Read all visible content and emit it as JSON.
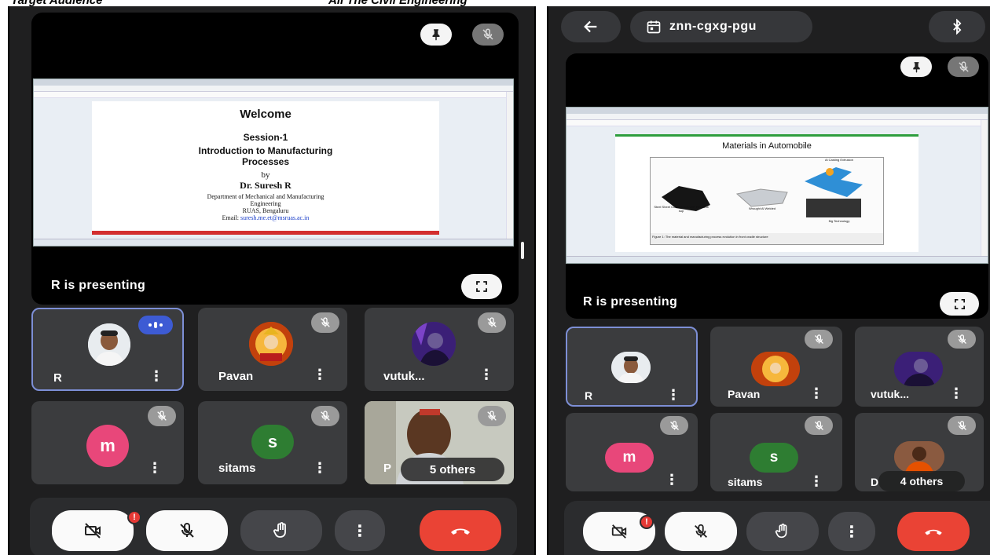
{
  "captions": {
    "left": "Target Audience",
    "right": "All The Civil Engineering"
  },
  "left_panel": {
    "slide": {
      "welcome": "Welcome",
      "session": "Session-1",
      "title_line1": "Introduction to Manufacturing",
      "title_line2": "Processes",
      "by": "by",
      "author": "Dr. Suresh R",
      "dept_line1": "Department of Mechanical and Manufacturing",
      "dept_line2": "Engineering",
      "org": "RUAS, Bengaluru",
      "email_label": "Email:",
      "email": "suresh.me.et@msruas.ac.in"
    },
    "presenting_label": "R is presenting",
    "participants": [
      {
        "name": "R",
        "kind": "photo"
      },
      {
        "name": "Pavan",
        "kind": "deity"
      },
      {
        "name": "vutuk...",
        "kind": "portrait"
      },
      {
        "name": "",
        "initial": "m",
        "color": "#e8477a"
      },
      {
        "name": "sitams",
        "initial": "s",
        "color": "#2e7d32"
      },
      {
        "name": "P",
        "kind": "video"
      }
    ],
    "others_label": "5 others",
    "alert_count": "!"
  },
  "right_panel": {
    "meeting_code": "znn-cgxg-pgu",
    "slide": {
      "title": "Materials in Automobile",
      "label1": "Steel Sheet Construction with Rectal36 sup",
      "label2": "Wrought Al Welded",
      "label3": "Al Casting Extrusion",
      "label4": "Mg Technology",
      "caption": "Figure 1: The material and manufacturing process evolution in front cradle structure"
    },
    "presenting_label": "R is presenting",
    "participants": [
      {
        "name": "R",
        "kind": "photo"
      },
      {
        "name": "Pavan",
        "kind": "deity"
      },
      {
        "name": "vutuk...",
        "kind": "portrait"
      },
      {
        "name": "",
        "initial": "m",
        "color": "#e8477a"
      },
      {
        "name": "sitams",
        "initial": "s",
        "color": "#2e7d32"
      },
      {
        "name": "D",
        "kind": "photo2"
      }
    ],
    "others_label": "4 others",
    "alert_count": "!"
  },
  "colors": {
    "background": "#1f1f20",
    "tile": "#3b3c3e",
    "active_border": "#7d8fd6",
    "end_call": "#ea4335",
    "speaking_badge": "#3d5bd4"
  },
  "icons": [
    "pin-icon",
    "mic-off-icon",
    "fullscreen-icon",
    "more-vert-icon",
    "camera-off-icon",
    "raise-hand-icon",
    "end-call-icon",
    "back-arrow-icon",
    "calendar-icon",
    "bluetooth-icon"
  ]
}
